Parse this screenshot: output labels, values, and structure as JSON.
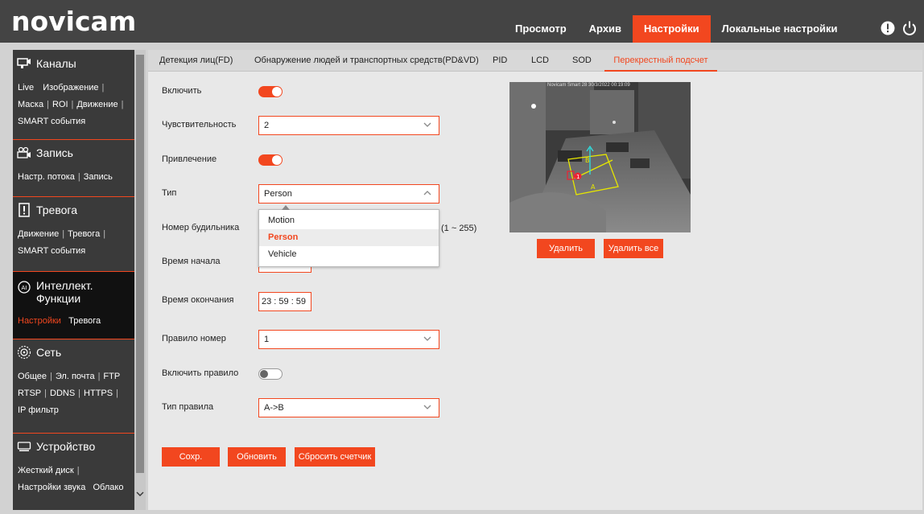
{
  "app": {
    "logo": "novicam"
  },
  "topnav": {
    "items": [
      {
        "label": "Просмотр",
        "active": false
      },
      {
        "label": "Архив",
        "active": false
      },
      {
        "label": "Настройки",
        "active": true
      },
      {
        "label": "Локальные настройки",
        "active": false
      }
    ],
    "icons": [
      "info-icon",
      "power-icon"
    ]
  },
  "sidebar": {
    "groups": [
      {
        "title": "Каналы",
        "icon": "channels-icon",
        "links": [
          "Live",
          "Изображение",
          "Маска",
          "ROI",
          "Движение",
          "SMART события"
        ]
      },
      {
        "title": "Запись",
        "icon": "record-icon",
        "links": [
          "Настр. потока",
          "Запись"
        ]
      },
      {
        "title": "Тревога",
        "icon": "alarm-icon",
        "links": [
          "Движение",
          "Тревога",
          "SMART события"
        ]
      },
      {
        "title": "Интеллект. Функции",
        "title_line1": "Интеллект.",
        "title_line2": "Функции",
        "icon": "ai-icon",
        "active": true,
        "links": [
          "Настройки",
          "Тревога"
        ],
        "active_link": "Настройки"
      },
      {
        "title": "Сеть",
        "icon": "network-icon",
        "links": [
          "Общее",
          "Эл. почта",
          "FTP",
          "RTSP",
          "DDNS",
          "HTTPS",
          "IP фильтр"
        ]
      },
      {
        "title": "Устройство",
        "icon": "device-icon",
        "links": [
          "Жесткий диск",
          "Настройки звука",
          "Облако"
        ]
      }
    ]
  },
  "tabs": [
    {
      "label": "Детекция лиц(FD)",
      "active": false
    },
    {
      "label": "Обнаружение людей и транспортных средств(PD&VD)",
      "active": false
    },
    {
      "label": "PID",
      "active": false
    },
    {
      "label": "LCD",
      "active": false
    },
    {
      "label": "SOD",
      "active": false
    },
    {
      "label": "Перекрестный подсчет",
      "active": true
    }
  ],
  "form": {
    "enable_label": "Включить",
    "enable_on": true,
    "sensitivity_label": "Чувствительность",
    "sensitivity_value": "2",
    "attract_label": "Привлечение",
    "attract_on": true,
    "type_label": "Тип",
    "type_value": "Person",
    "type_options": [
      "Motion",
      "Person",
      "Vehicle"
    ],
    "alarm_number_label": "Номер будильника",
    "alarm_number_range": "(1 ~ 255)",
    "start_time_label": "Время начала",
    "end_time_label": "Время окончания",
    "end_time_value": "23 : 59 : 59",
    "rule_number_label": "Правило номер",
    "rule_number_value": "1",
    "enable_rule_label": "Включить правило",
    "enable_rule_on": false,
    "rule_type_label": "Тип правила",
    "rule_type_value": "A->B"
  },
  "buttons": {
    "save": "Сохр.",
    "refresh": "Обновить",
    "reset_counter": "Сбросить счетчик",
    "delete": "Удалить",
    "delete_all": "Удалить все"
  },
  "preview": {
    "osd_text": "Novicam Smart 28  30/3/2022 00:19:09",
    "line_labels": [
      "A",
      "B"
    ]
  },
  "colors": {
    "accent": "#f2471f",
    "topbar": "#444444",
    "sidebar": "#3a3a3a"
  }
}
